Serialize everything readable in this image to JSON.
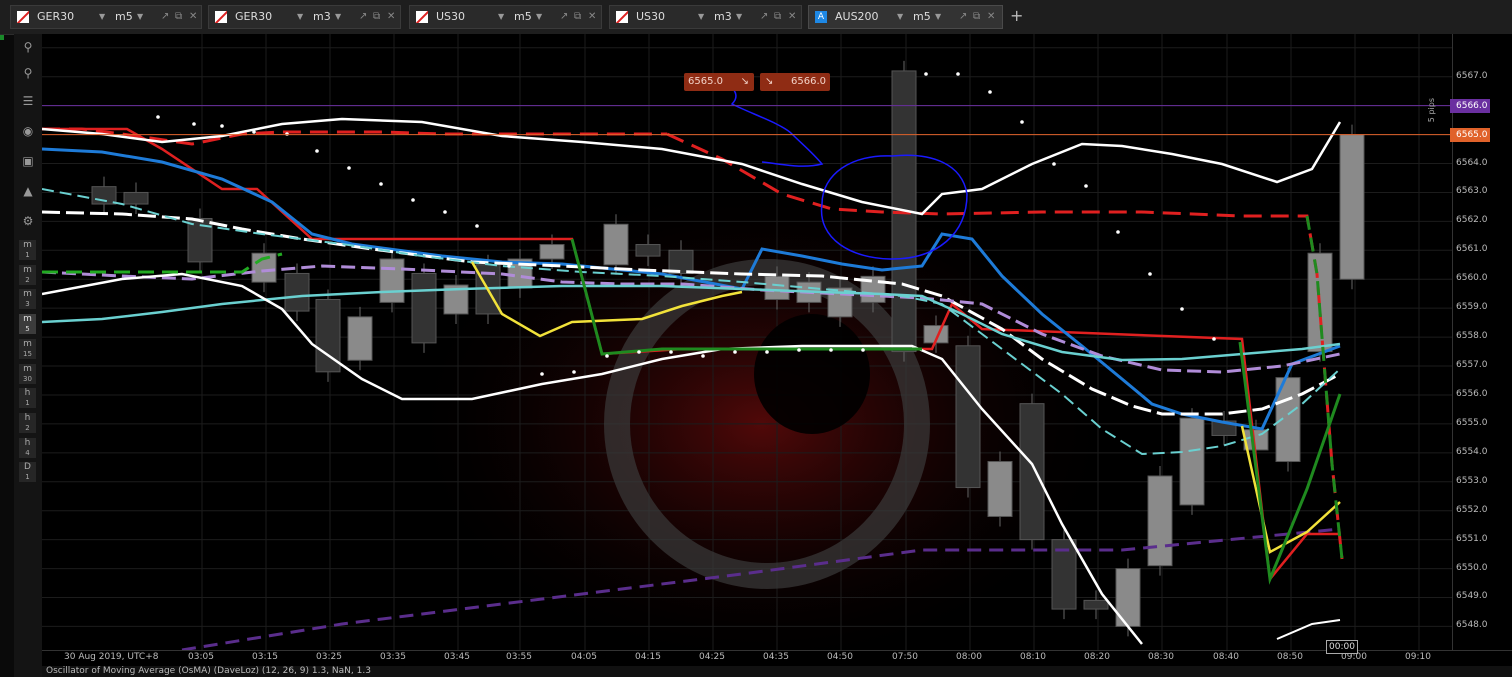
{
  "tabs": [
    {
      "symbol": "GER30",
      "timeframe": "m5",
      "active": false
    },
    {
      "symbol": "GER30",
      "timeframe": "m3",
      "active": false
    },
    {
      "symbol": "US30",
      "timeframe": "m5",
      "active": false
    },
    {
      "symbol": "US30",
      "timeframe": "m3",
      "active": false
    },
    {
      "symbol": "AUS200",
      "timeframe": "m5",
      "active": true
    }
  ],
  "aus_icon_letter": "A",
  "add_tab_label": "+",
  "timeframe_buttons": [
    "m1",
    "m2",
    "m3",
    "m5",
    "m15",
    "m30",
    "h1",
    "h2",
    "h4",
    "D1"
  ],
  "active_timeframe": "m5",
  "order_buttons": {
    "sell": "6565.0",
    "buy": "6566.0"
  },
  "price_axis": {
    "ticks": [
      "6566.0",
      "6567.0",
      "6563.0",
      "6564.0",
      "6562.0",
      "6561.0",
      "6560.0",
      "6559.0",
      "6558.0",
      "6557.0",
      "6556.0",
      "6555.0",
      "6554.0",
      "6553.0",
      "6552.0",
      "6551.0",
      "6550.0",
      "6549.0",
      "6548.0"
    ],
    "ask_label": "6566.0",
    "bid_label": "6565.0",
    "pips_label": "5 pips",
    "ask_color": "#6a2fa0",
    "bid_color": "#e0622a"
  },
  "time_axis": {
    "date_label": "30 Aug 2019, UTC+8",
    "ticks": [
      "03:05",
      "03:15",
      "03:25",
      "03:35",
      "03:45",
      "03:55",
      "04:05",
      "04:15",
      "04:25",
      "04:35",
      "04:50",
      "07:50",
      "08:00",
      "08:10",
      "08:20",
      "08:30",
      "08:40",
      "08:50",
      "09:00",
      "09:10"
    ],
    "current_time": "00:00"
  },
  "indicator_label": "Oscillator of Moving Average (OsMA) (DaveLoz) (12, 26, 9) 1.3, NaN, 1.3",
  "chart_data": {
    "type": "candlestick",
    "symbol": "AUS200",
    "timeframe": "m5",
    "ylim": [
      6547.6,
      6568.2
    ],
    "candles": [
      {
        "x": "03:00",
        "open": 6563.2,
        "close": 6562.6
      },
      {
        "x": "03:05",
        "open": 6563.0,
        "close": 6562.6
      },
      {
        "x": "03:10",
        "open": 6562.1,
        "close": 6560.6
      },
      {
        "x": "03:15",
        "open": 6559.9,
        "close": 6560.9
      },
      {
        "x": "03:20",
        "open": 6560.2,
        "close": 6558.9
      },
      {
        "x": "03:25",
        "open": 6559.3,
        "close": 6556.8
      },
      {
        "x": "03:30",
        "open": 6557.2,
        "close": 6558.7
      },
      {
        "x": "03:35",
        "open": 6559.2,
        "close": 6560.7
      },
      {
        "x": "03:40",
        "open": 6560.2,
        "close": 6557.8
      },
      {
        "x": "03:45",
        "open": 6558.8,
        "close": 6559.8
      },
      {
        "x": "03:50",
        "open": 6560.5,
        "close": 6558.8
      },
      {
        "x": "03:55",
        "open": 6559.7,
        "close": 6560.7
      },
      {
        "x": "04:00",
        "open": 6560.7,
        "close": 6561.2
      },
      {
        "x": "04:05",
        "open": 6560.5,
        "close": 6561.9
      },
      {
        "x": "04:10",
        "open": 6561.2,
        "close": 6560.8
      },
      {
        "x": "04:15",
        "open": 6561.0,
        "close": 6560.2
      },
      {
        "x": "04:30",
        "open": 6559.3,
        "close": 6560.1
      },
      {
        "x": "04:40",
        "open": 6559.2,
        "close": 6559.9
      },
      {
        "x": "04:45",
        "open": 6558.7,
        "close": 6559.7
      },
      {
        "x": "04:50",
        "open": 6559.2,
        "close": 6560.1
      },
      {
        "x": "07:45",
        "open": 6567.2,
        "close": 6557.5
      },
      {
        "x": "07:50",
        "open": 6557.8,
        "close": 6558.4
      },
      {
        "x": "07:55",
        "open": 6557.7,
        "close": 6552.8
      },
      {
        "x": "08:00",
        "open": 6551.8,
        "close": 6553.7
      },
      {
        "x": "08:05",
        "open": 6555.7,
        "close": 6551.0
      },
      {
        "x": "08:10",
        "open": 6551.0,
        "close": 6548.6
      },
      {
        "x": "08:15",
        "open": 6548.9,
        "close": 6548.6
      },
      {
        "x": "08:20",
        "open": 6548.0,
        "close": 6550.0
      },
      {
        "x": "08:25",
        "open": 6550.1,
        "close": 6553.2
      },
      {
        "x": "08:30",
        "open": 6552.2,
        "close": 6555.2
      },
      {
        "x": "08:35",
        "open": 6555.1,
        "close": 6554.6
      },
      {
        "x": "08:40",
        "open": 6554.1,
        "close": 6554.8
      },
      {
        "x": "08:45",
        "open": 6553.7,
        "close": 6556.6
      },
      {
        "x": "08:50",
        "open": 6557.5,
        "close": 6560.9
      },
      {
        "x": "08:55",
        "open": 6560.0,
        "close": 6565.0
      }
    ],
    "current_ask": 6566.0,
    "current_bid": 6565.0
  },
  "colors": {
    "background": "#000000",
    "bull_candle": "#8a8a8a",
    "bear_candle": "#333333",
    "grid": "#1c1c1c"
  }
}
